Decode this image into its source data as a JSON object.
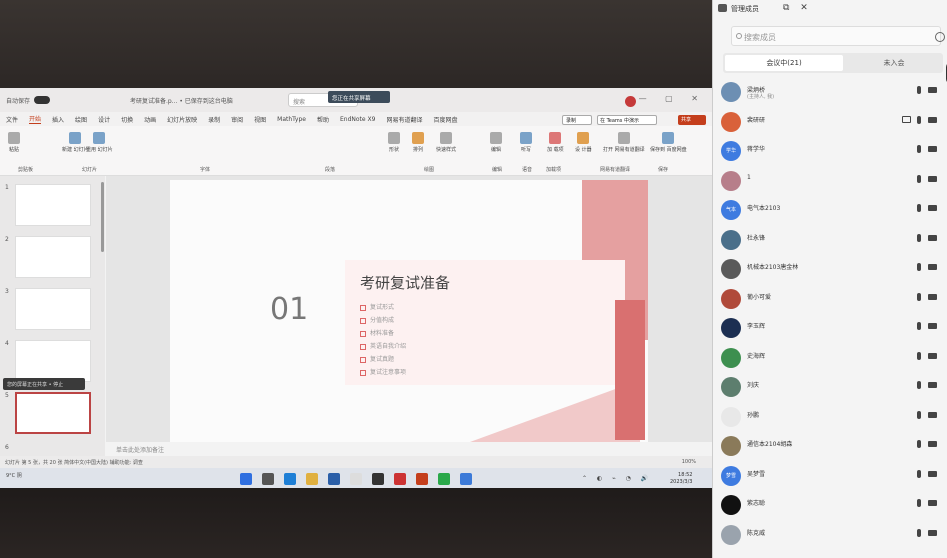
{
  "meeting_panel": {
    "title": "管理成员",
    "search_placeholder": "搜索成员",
    "tabs": [
      {
        "label": "会议中(21)"
      },
      {
        "label": "未入会"
      }
    ],
    "members": [
      {
        "name": "梁炳桥",
        "sub": "(主持人, 我)",
        "avatar_text": "",
        "avatar_color": "#6d8fb3"
      },
      {
        "name": "裴研研",
        "sub": "",
        "avatar_text": "",
        "avatar_color": "#d9613a",
        "sharing": true
      },
      {
        "name": "蒋学华",
        "sub": "",
        "avatar_text": "学华",
        "avatar_color": "#3e7be0"
      },
      {
        "name": "1",
        "sub": "",
        "avatar_text": "",
        "avatar_color": "#b77e8a"
      },
      {
        "name": "电气本2103",
        "sub": "",
        "avatar_text": "气本",
        "avatar_color": "#3e7be0"
      },
      {
        "name": "杜永锋",
        "sub": "",
        "avatar_text": "",
        "avatar_color": "#4a6f8a"
      },
      {
        "name": "机械本2103唐金林",
        "sub": "",
        "avatar_text": "",
        "avatar_color": "#5a5a5a"
      },
      {
        "name": "葡小可爱",
        "sub": "",
        "avatar_text": "",
        "avatar_color": "#b04a3a"
      },
      {
        "name": "李玉辉",
        "sub": "",
        "avatar_text": "",
        "avatar_color": "#1c2f52"
      },
      {
        "name": "史海辉",
        "sub": "",
        "avatar_text": "",
        "avatar_color": "#3d8f4f"
      },
      {
        "name": "刘庆",
        "sub": "",
        "avatar_text": "",
        "avatar_color": "#5d7e6e"
      },
      {
        "name": "孙鹏",
        "sub": "",
        "avatar_text": "",
        "avatar_color": "#e8e8e8"
      },
      {
        "name": "通信本2104胡森",
        "sub": "",
        "avatar_text": "",
        "avatar_color": "#8a7a5a"
      },
      {
        "name": "吴梦雪",
        "sub": "",
        "avatar_text": "梦雪",
        "avatar_color": "#3e7be0"
      },
      {
        "name": "紫志聪",
        "sub": "",
        "avatar_text": "",
        "avatar_color": "#111111"
      },
      {
        "name": "陈克威",
        "sub": "",
        "avatar_text": "",
        "avatar_color": "#9aa3ad"
      }
    ]
  },
  "ppt": {
    "title_bar": {
      "autosave": "自动保存",
      "doc_title": "考研复试准备.p...  • 已保存到这台电脑",
      "search": "搜索",
      "share_banner": "您正在共享屏幕"
    },
    "menu": [
      "文件",
      "开始",
      "插入",
      "绘图",
      "设计",
      "切换",
      "动画",
      "幻灯片放映",
      "录制",
      "审阅",
      "视图",
      "MathType",
      "帮助",
      "EndNote X9",
      "网易有道翻译",
      "百度网盘"
    ],
    "menu_active": "开始",
    "record_label": "录制",
    "teams_label": "在 Teams 中演示",
    "share_label": "共享",
    "ribbon_groups": [
      "剪贴板",
      "幻灯片",
      "字体",
      "段落",
      "绘图",
      "编辑",
      "语音",
      "加载项",
      "网易有道翻译",
      "保存"
    ],
    "ribbon_buttons": [
      "粘贴",
      "新建\n幻灯片",
      "重用\n幻灯片",
      "形状",
      "排列",
      "快速样式",
      "编辑",
      "听写",
      "加\n载项",
      "设\n计器",
      "打开\n网易有道翻译",
      "保存到\n百度网盘"
    ],
    "slide": {
      "number": "01",
      "title": "考研复试准备",
      "items": [
        "复试形式",
        "分值构成",
        "材料准备",
        "英语自我介绍",
        "复试真题",
        "复试注意事项"
      ]
    },
    "thumb_numbers": [
      "1",
      "2",
      "3",
      "4",
      "5",
      "6"
    ],
    "thumb_tooltip": "您的屏幕正在共享  • 停止",
    "notes_placeholder": "单击此处添加备注",
    "status": "幻灯片 第 5 张，共 20 张   简体中文(中国大陆)   辅助功能: 调查",
    "zoom": "100%"
  },
  "taskbar": {
    "weather": "9°C\n阴",
    "time": "18:52",
    "date": "2023/3/3"
  }
}
